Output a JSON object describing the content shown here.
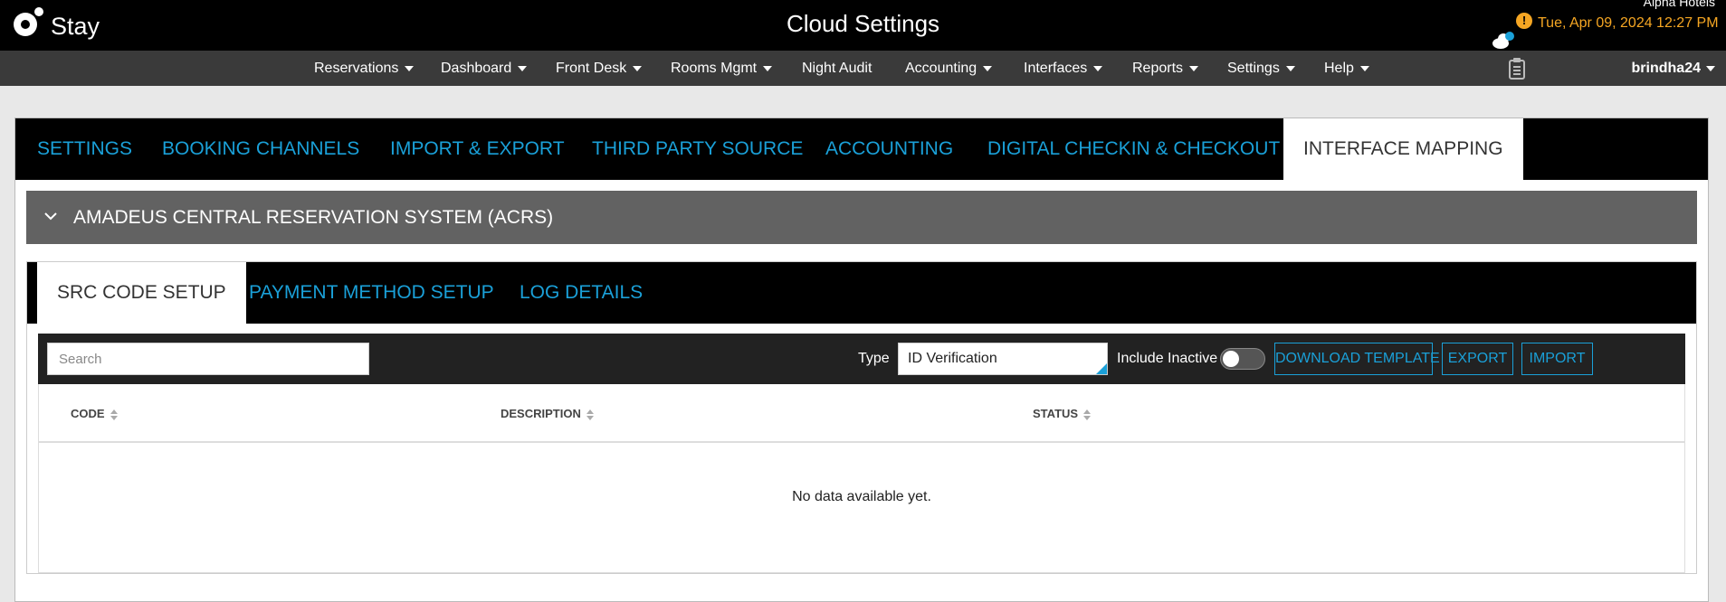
{
  "header": {
    "logo_text": "Stay",
    "title": "Cloud Settings",
    "hotel_name": "Alpha Hotels",
    "alert_symbol": "!",
    "datetime": "Tue, Apr 09, 2024 12:27 PM",
    "accent_color": "#f5a623"
  },
  "nav": {
    "items": [
      {
        "label": "Reservations",
        "dropdown": true
      },
      {
        "label": "Dashboard",
        "dropdown": true
      },
      {
        "label": "Front Desk",
        "dropdown": true
      },
      {
        "label": "Rooms Mgmt",
        "dropdown": true
      },
      {
        "label": "Night Audit",
        "dropdown": false
      },
      {
        "label": "Accounting",
        "dropdown": true
      },
      {
        "label": "Interfaces",
        "dropdown": true
      },
      {
        "label": "Reports",
        "dropdown": true
      },
      {
        "label": "Settings",
        "dropdown": true
      },
      {
        "label": "Help",
        "dropdown": true
      }
    ],
    "user": "brindha24"
  },
  "tabs": [
    {
      "label": "SETTINGS"
    },
    {
      "label": "BOOKING CHANNELS"
    },
    {
      "label": "IMPORT & EXPORT"
    },
    {
      "label": "THIRD PARTY SOURCE"
    },
    {
      "label": "ACCOUNTING"
    },
    {
      "label": "DIGITAL CHECKIN & CHECKOUT"
    },
    {
      "label": "INTERFACE MAPPING",
      "active": true
    }
  ],
  "section": {
    "title": "AMADEUS CENTRAL RESERVATION SYSTEM (ACRS)"
  },
  "subtabs": [
    {
      "label": "SRC CODE SETUP",
      "active": true
    },
    {
      "label": "PAYMENT METHOD SETUP"
    },
    {
      "label": "LOG DETAILS"
    }
  ],
  "toolbar": {
    "search_placeholder": "Search",
    "type_label": "Type",
    "type_value": "ID Verification",
    "include_inactive_label": "Include Inactive",
    "include_inactive": false,
    "download_label": "DOWNLOAD TEMPLATE",
    "export_label": "EXPORT",
    "import_label": "IMPORT"
  },
  "table": {
    "columns": [
      "CODE",
      "DESCRIPTION",
      "STATUS"
    ],
    "rows": [],
    "empty_message": "No data available yet."
  },
  "colors": {
    "link_blue": "#1aa0d8",
    "section_gray": "#626262"
  }
}
